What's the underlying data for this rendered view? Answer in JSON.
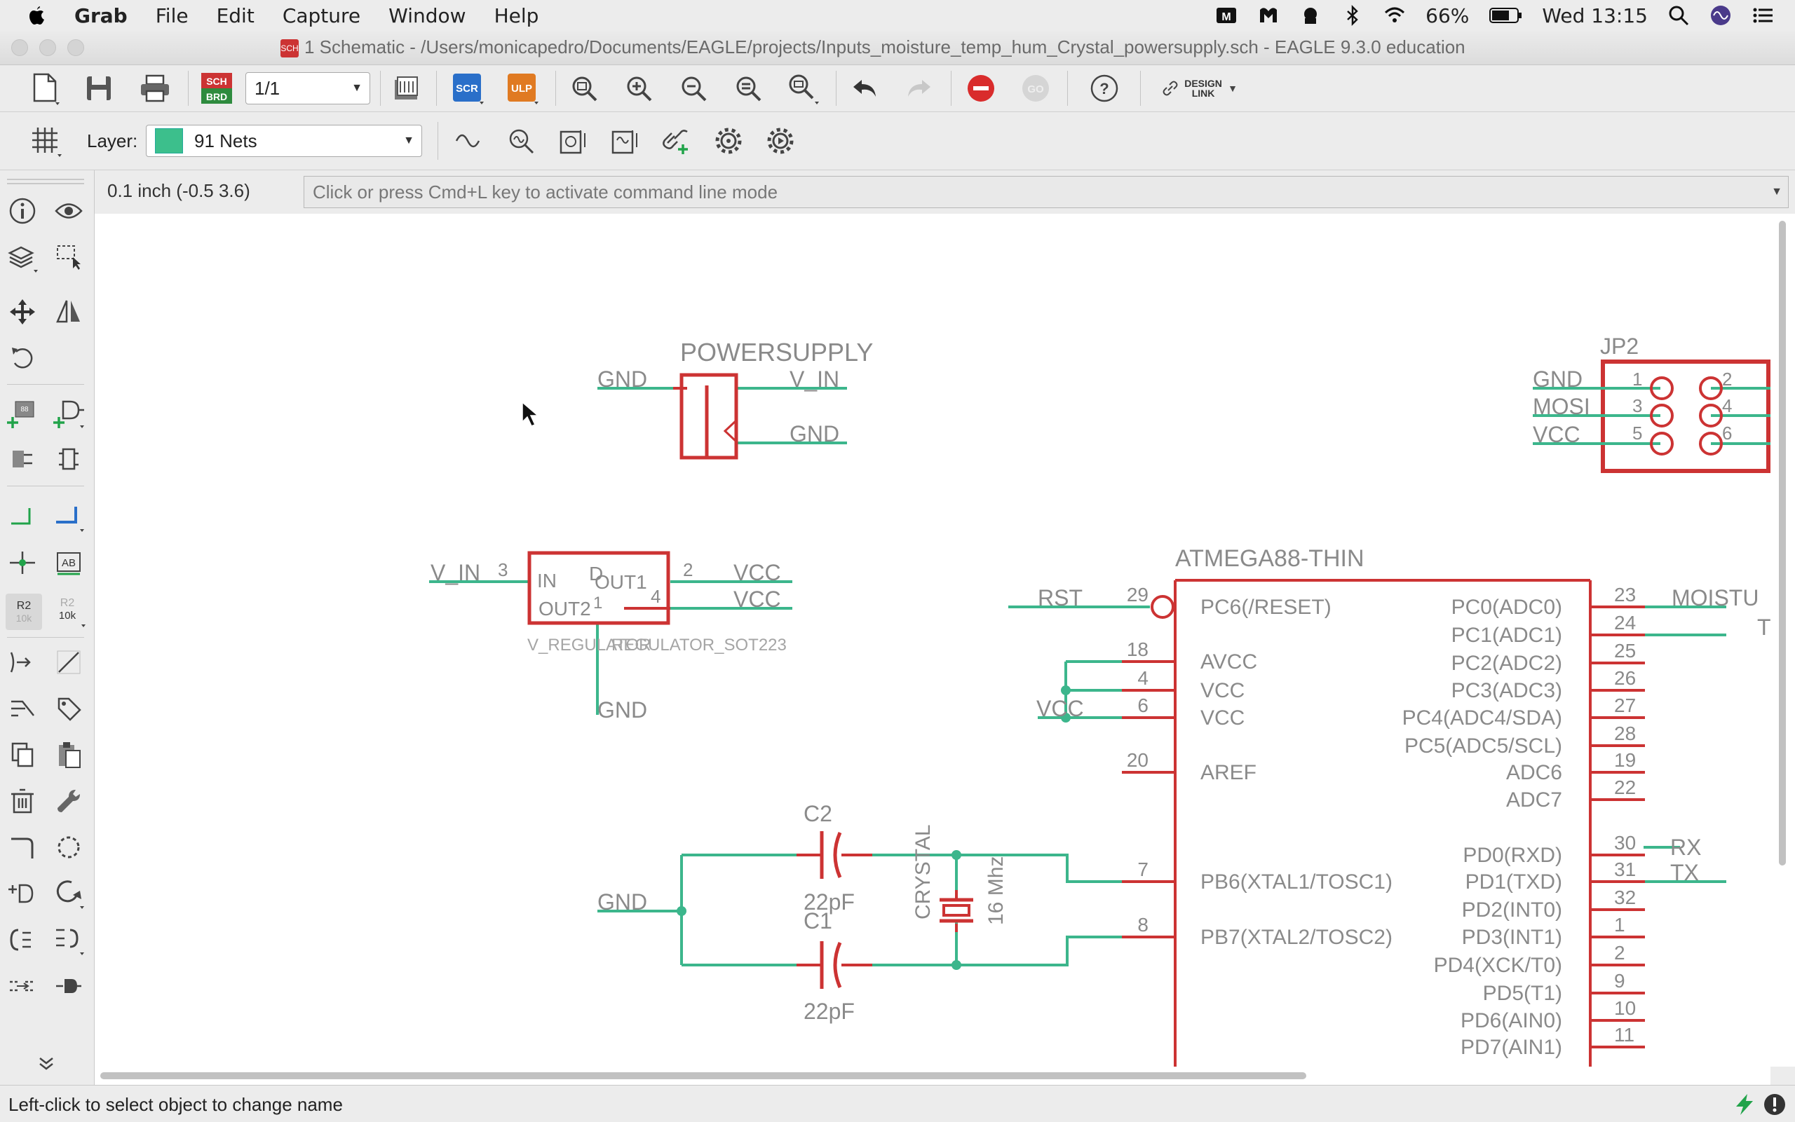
{
  "menubar": {
    "app": "Grab",
    "items": [
      "File",
      "Edit",
      "Capture",
      "Window",
      "Help"
    ],
    "battery": "66%",
    "clock": "Wed 13:15"
  },
  "window": {
    "title": "1 Schematic - /Users/monicapedro/Documents/EAGLE/projects/Inputs_moisture_temp_hum_Crystal_powersupply.sch - EAGLE 9.3.0 education",
    "doc_badge": "SCH"
  },
  "toolbar": {
    "sheet": "1/1",
    "sch_brd": "SCH BRD",
    "scr": "SCR",
    "ulp": "ULP",
    "go": "GO",
    "help": "?",
    "design_link": "DESIGN LINK"
  },
  "layerbar": {
    "label": "Layer:",
    "layer": "91 Nets",
    "layer_color": "#3cbf8c"
  },
  "commandbar": {
    "coords": "0.1 inch (-0.5 3.6)",
    "placeholder": "Click or press Cmd+L key to activate command line mode"
  },
  "toolbox": {
    "name_tool_a": "R2",
    "name_tool_b": "10k",
    "value_tool_a": "R2",
    "value_tool_b": "10k",
    "label_tool": "AB"
  },
  "schematic": {
    "colors": {
      "net": "#3cb68c",
      "symbol": "#cc3333",
      "text": "#8a8a8a"
    },
    "powersupply": {
      "name": "POWERSUPPLY",
      "gnd": "GND",
      "vin": "V_IN",
      "gnd2": "GND"
    },
    "regulator": {
      "in_net": "V_IN",
      "pin_in": "3",
      "in": "IN",
      "out1": "OUT1",
      "out2": "OUT2",
      "pin_out1": "2",
      "pin_out2": "4",
      "gnd_pin": "1",
      "vcc1": "VCC",
      "vcc2": "VCC",
      "name": "V_REGULATOR",
      "value": "REGULATOR_SOT223",
      "gnd": "GND",
      "overlap": "D"
    },
    "jp2": {
      "name": "JP2",
      "gnd": "GND",
      "mosi": "MOSI",
      "vcc": "VCC",
      "pins": [
        "1",
        "2",
        "3",
        "4",
        "5",
        "6"
      ]
    },
    "crystal_section": {
      "gnd": "GND",
      "c2": "C2",
      "c2_val": "22pF",
      "c1": "C1",
      "c1_val": "22pF",
      "crystal": "CRYSTAL",
      "freq": "16 Mhz"
    },
    "mcu": {
      "name": "ATMEGA88-THIN",
      "rst": "RST",
      "vcc": "VCC",
      "left_pins": [
        {
          "num": "29",
          "label": "PC6(/RESET)"
        },
        {
          "num": "18",
          "label": "AVCC"
        },
        {
          "num": "4",
          "label": "VCC"
        },
        {
          "num": "6",
          "label": "VCC"
        },
        {
          "num": "20",
          "label": "AREF"
        },
        {
          "num": "7",
          "label": "PB6(XTAL1/TOSC1)"
        },
        {
          "num": "8",
          "label": "PB7(XTAL2/TOSC2)"
        }
      ],
      "right_pins": [
        {
          "num": "23",
          "label": "PC0(ADC0)"
        },
        {
          "num": "24",
          "label": "PC1(ADC1)"
        },
        {
          "num": "25",
          "label": "PC2(ADC2)"
        },
        {
          "num": "26",
          "label": "PC3(ADC3)"
        },
        {
          "num": "27",
          "label": "PC4(ADC4/SDA)"
        },
        {
          "num": "28",
          "label": "PC5(ADC5/SCL)"
        },
        {
          "num": "19",
          "label": "ADC6"
        },
        {
          "num": "22",
          "label": "ADC7"
        },
        {
          "num": "30",
          "label": "PD0(RXD)"
        },
        {
          "num": "31",
          "label": "PD1(TXD)"
        },
        {
          "num": "32",
          "label": "PD2(INT0)"
        },
        {
          "num": "1",
          "label": "PD3(INT1)"
        },
        {
          "num": "2",
          "label": "PD4(XCK/T0)"
        },
        {
          "num": "9",
          "label": "PD5(T1)"
        },
        {
          "num": "10",
          "label": "PD6(AIN0)"
        },
        {
          "num": "11",
          "label": "PD7(AIN1)"
        }
      ],
      "right_nets": {
        "moisture": "MOISTU",
        "temp": "TEM",
        "rx": "RX",
        "tx": "TX"
      }
    }
  },
  "statusbar": {
    "text": "Left-click to select object to change name"
  }
}
